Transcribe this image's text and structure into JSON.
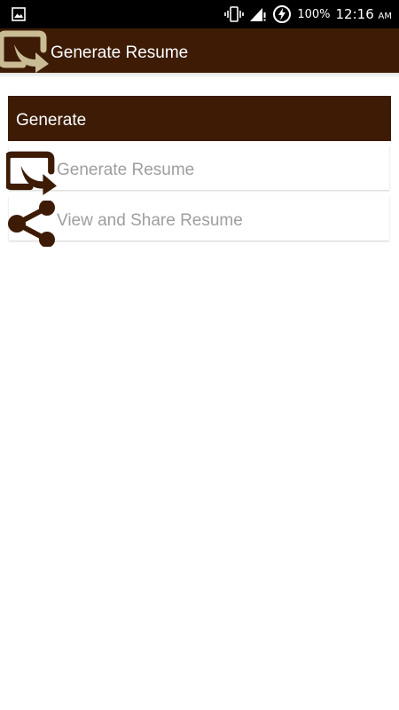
{
  "status_bar": {
    "battery": "100%",
    "time": "12:16",
    "ampm": "AM"
  },
  "app_bar": {
    "title": "Generate Resume"
  },
  "section": {
    "header": "Generate",
    "items": [
      {
        "label": "Generate Resume",
        "icon": "export-arrow-icon"
      },
      {
        "label": "View and Share Resume",
        "icon": "share-icon"
      }
    ]
  },
  "colors": {
    "primary_brown": "#3d1b04",
    "logo_tan": "#c9bc94",
    "item_text_gray": "#9e9e9e",
    "status_bar": "#000000"
  }
}
